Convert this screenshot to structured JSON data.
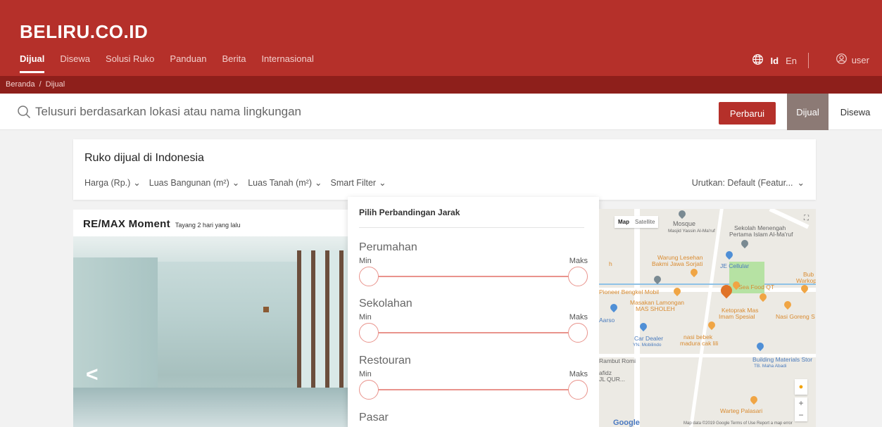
{
  "header": {
    "brand": "BELIRU.CO.ID",
    "nav": [
      "Dijual",
      "Disewa",
      "Solusi Ruko",
      "Panduan",
      "Berita",
      "Internasional"
    ],
    "active_nav": "Dijual",
    "lang_id": "Id",
    "lang_en": "En",
    "user_label": "user"
  },
  "breadcrumb": {
    "home": "Beranda",
    "current": "Dijual"
  },
  "search": {
    "placeholder": "Telusuri berdasarkan lokasi atau nama lingkungan",
    "update_label": "Perbarui",
    "sale_label": "Dijual",
    "rent_label": "Disewa"
  },
  "filters": {
    "title": "Ruko dijual di Indonesia",
    "items": [
      "Harga (Rp.)",
      "Luas Bangunan (m²)",
      "Luas Tanah (m²)",
      "Smart Filter"
    ],
    "sort_label": "Urutkan: Default (Featur..."
  },
  "listing": {
    "agent": "RE/MAX Moment",
    "posted": "Tayang 2 hari yang lalu",
    "prev_glyph": "<"
  },
  "smart_filter": {
    "title": "Pilih Perbandingan Jarak",
    "min_label": "Min",
    "max_label": "Maks",
    "ranges": [
      "Perumahan",
      "Sekolahan",
      "Restouran",
      "Pasar"
    ]
  },
  "map": {
    "type_map": "Map",
    "type_satellite": "Satellite",
    "labels": {
      "mosque": "Mosque",
      "mosque_sub": "Masjid Yassin Al-Ma'ruf",
      "school1": "Sekolah Menengah",
      "school2": "Pertama Islam Al-Ma'ruf",
      "warung1": "Warung Lesehan",
      "warung2": "Bakmi Jawa Sorjati",
      "je": "JE Cellular",
      "bub": "Bub",
      "warkop": "Warkop",
      "sea": "Sea Food QT",
      "pioneer": "Pioneer Bengkel Mobil",
      "masakan1": "Masakan Lamongan",
      "masakan2": "MAS SHOLEH",
      "ketoprak1": "Ketoprak Mas",
      "ketoprak2": "Imam Spesial",
      "nasi_goreng": "Nasi Goreng S",
      "arso": "Aarso",
      "car1": "Car Dealer",
      "car2": "YN. Mobilindo",
      "bebek1": "nasi bebek",
      "bebek2": "madura cak lili",
      "building1": "Building Materials Stor",
      "building2": "TB. Maha Abadi",
      "rambut": "Rambut Romi",
      "afidz1": "afidz",
      "afidz2": "JL QUR...",
      "h": "h",
      "warteg": "Warteg Palasari",
      "google": "Google",
      "attribution": "Map data ©2019 Google  Terms of Use  Report a map error"
    }
  }
}
